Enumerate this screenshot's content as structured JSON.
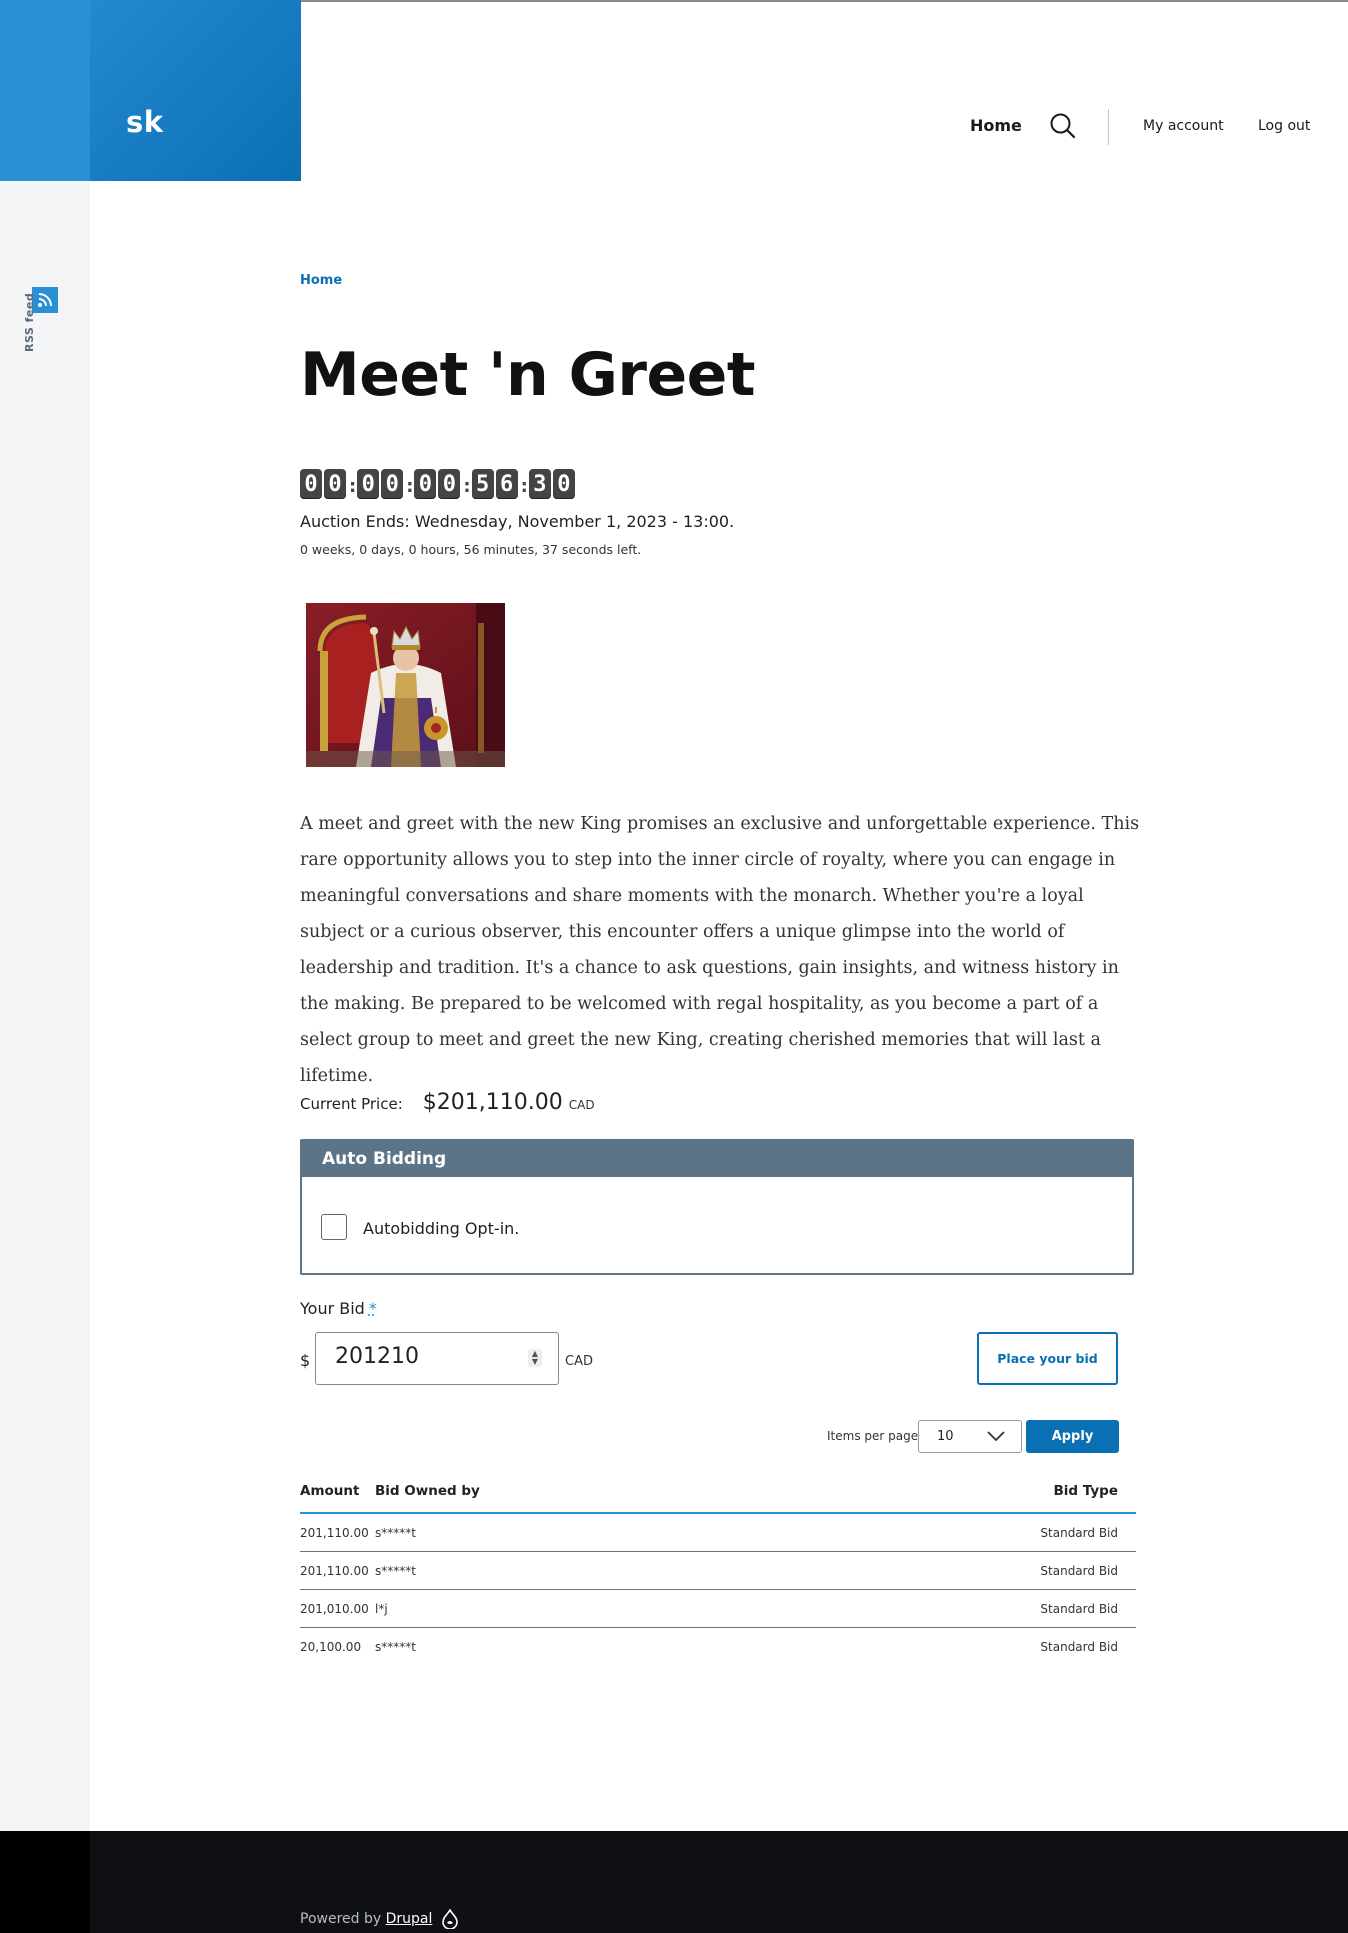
{
  "site": {
    "logo_text": "sk"
  },
  "nav": {
    "home": "Home",
    "my_account": "My account",
    "log_out": "Log out"
  },
  "sidebar": {
    "rss_label": "RSS feed"
  },
  "breadcrumb": {
    "home": "Home"
  },
  "page": {
    "title": "Meet 'n Greet"
  },
  "countdown": {
    "digits": [
      "0",
      "0",
      "0",
      "0",
      "0",
      "0",
      "5",
      "6",
      "3",
      "0"
    ]
  },
  "auction": {
    "ends": "Auction Ends: Wednesday, November 1, 2023 - 13:00.",
    "time_left": "0 weeks, 0 days, 0 hours, 56 minutes, 37 seconds left."
  },
  "description": "A meet and greet with the new King promises an exclusive and unforgettable experience. This rare opportunity allows you to step into the inner circle of royalty, where you can engage in meaningful conversations and share moments with the monarch. Whether you're a loyal subject or a curious observer, this encounter offers a unique glimpse into the world of leadership and tradition. It's a chance to ask questions, gain insights, and witness history in the making. Be prepared to be welcomed with regal hospitality, as you become a part of a select group to meet and greet the new King, creating cherished memories that will last a lifetime.",
  "price": {
    "label": "Current Price:",
    "value": "$201,110.00",
    "currency": "CAD"
  },
  "auto_bidding": {
    "legend": "Auto Bidding",
    "optin_label": "Autobidding Opt-in.",
    "checked": false
  },
  "bid_form": {
    "label": "Your Bid",
    "required_mark": "*",
    "prefix": "$",
    "value": "201210",
    "currency": "CAD",
    "submit": "Place your bid"
  },
  "pager": {
    "items_per_page_label": "Items per page",
    "items_per_page_value": "10",
    "apply": "Apply"
  },
  "bids_table": {
    "headers": {
      "amount": "Amount",
      "owner": "Bid Owned by",
      "type": "Bid Type"
    },
    "rows": [
      {
        "amount": "201,110.00",
        "owner": "s*****t",
        "type": "Standard Bid"
      },
      {
        "amount": "201,110.00",
        "owner": "s*****t",
        "type": "Standard Bid"
      },
      {
        "amount": "201,010.00",
        "owner": "l*j",
        "type": "Standard Bid"
      },
      {
        "amount": "20,100.00",
        "owner": "s*****t",
        "type": "Standard Bid"
      }
    ]
  },
  "footer": {
    "powered_by": "Powered by",
    "drupal": "Drupal"
  },
  "colors": {
    "brand_blue": "#0b6fb3",
    "accent_blue": "#2b8fd4",
    "slate": "#5c7487",
    "footer_bg": "#0f1013"
  },
  "icons": {
    "search": "search-icon",
    "rss": "rss-icon",
    "drupal": "drupal-drop-icon",
    "chevron": "chevron-down-icon"
  }
}
